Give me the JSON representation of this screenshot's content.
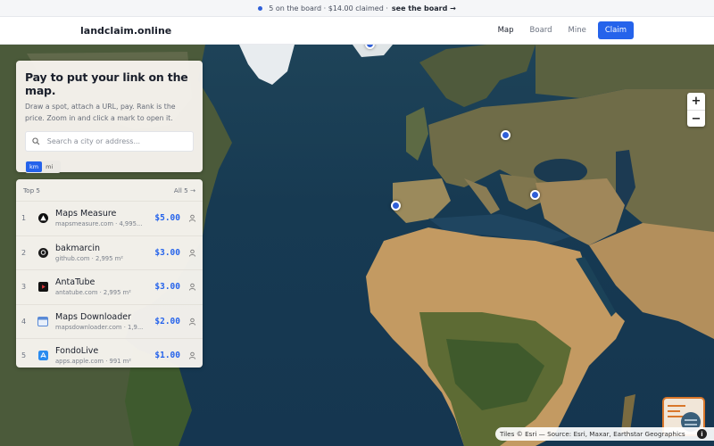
{
  "announcement": {
    "text": "5 on the board · $14.00 claimed ·",
    "link": "see the board →"
  },
  "header": {
    "logo": "landclaim.online",
    "nav": [
      {
        "label": "Map",
        "active": true
      },
      {
        "label": "Board",
        "active": false
      },
      {
        "label": "Mine",
        "active": false
      }
    ],
    "claim_label": "Claim"
  },
  "intro": {
    "title": "Pay to put your link on the map.",
    "description": "Draw a spot, attach a URL, pay. Rank is the price. Zoom in and click a mark to open it.",
    "search_placeholder": "Search a city or address...",
    "units": [
      "km",
      "mi"
    ],
    "selected_unit": "km"
  },
  "top5": {
    "title": "Top 5",
    "all_link": "All 5 →",
    "rows": [
      {
        "rank": "1",
        "name": "Maps Measure",
        "sub": "mapsmeasure.com · 4,995...",
        "price": "$5.00",
        "icon": "triangle-logo-icon"
      },
      {
        "rank": "2",
        "name": "bakmarcin",
        "sub": "github.com · 2,995 m²",
        "price": "$3.00",
        "icon": "github-icon"
      },
      {
        "rank": "3",
        "name": "AntaTube",
        "sub": "antatube.com · 2,995 m²",
        "price": "$3.00",
        "icon": "play-icon"
      },
      {
        "rank": "4",
        "name": "Maps Downloader",
        "sub": "mapsdownloader.com · 1,9...",
        "price": "$2.00",
        "icon": "window-icon"
      },
      {
        "rank": "5",
        "name": "FondoLive",
        "sub": "apps.apple.com · 991 m²",
        "price": "$1.00",
        "icon": "app-store-icon"
      }
    ]
  },
  "zoom": {
    "in": "+",
    "out": "−"
  },
  "attribution": "Tiles © Esri — Source: Esri, Maxar, Earthstar Geographics",
  "colors": {
    "accent": "#2563eb",
    "marker": "#2f5fd8"
  }
}
